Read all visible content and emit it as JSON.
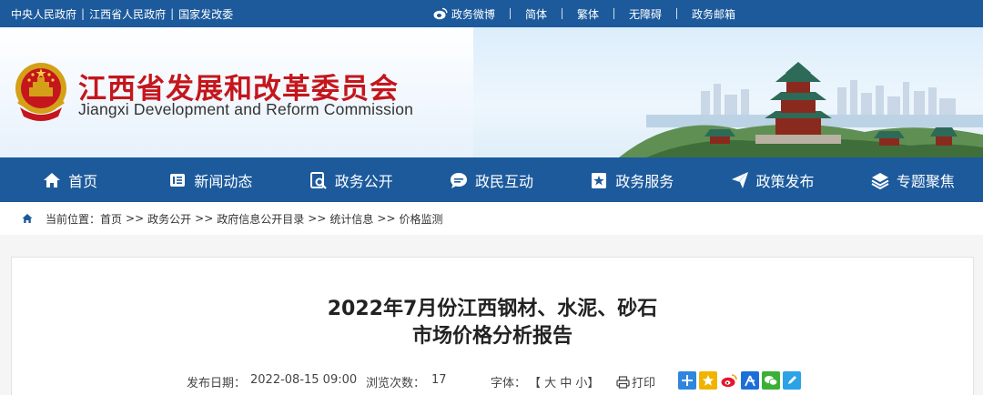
{
  "topbar": {
    "left_links": [
      "中央人民政府",
      "江西省人民政府",
      "国家发改委"
    ],
    "right_links": [
      "政务微博",
      "简体",
      "繁体",
      "无障碍",
      "政务邮箱"
    ]
  },
  "header": {
    "title_cn": "江西省发展和改革委员会",
    "title_en": "Jiangxi Development and Reform Commission"
  },
  "nav": {
    "items": [
      "首页",
      "新闻动态",
      "政务公开",
      "政民互动",
      "政务服务",
      "政策发布",
      "专题聚焦"
    ]
  },
  "breadcrumb": {
    "label": "当前位置：",
    "items": [
      "首页",
      "政务公开",
      "政府信息公开目录",
      "统计信息",
      "价格监测"
    ],
    "separator": ">>"
  },
  "article": {
    "title_line1": "2022年7月份江西钢材、水泥、砂石",
    "title_line2": "市场价格分析报告",
    "date_label": "发布日期：",
    "date_value": "2022-08-15 09:00",
    "views_label": "浏览次数：",
    "views_value": "17",
    "font_label": "字体：",
    "font_sizes": "【 大 中 小】",
    "print_label": "打印"
  },
  "colors": {
    "primary": "#1c5a9c",
    "title_red": "#c4161c"
  }
}
